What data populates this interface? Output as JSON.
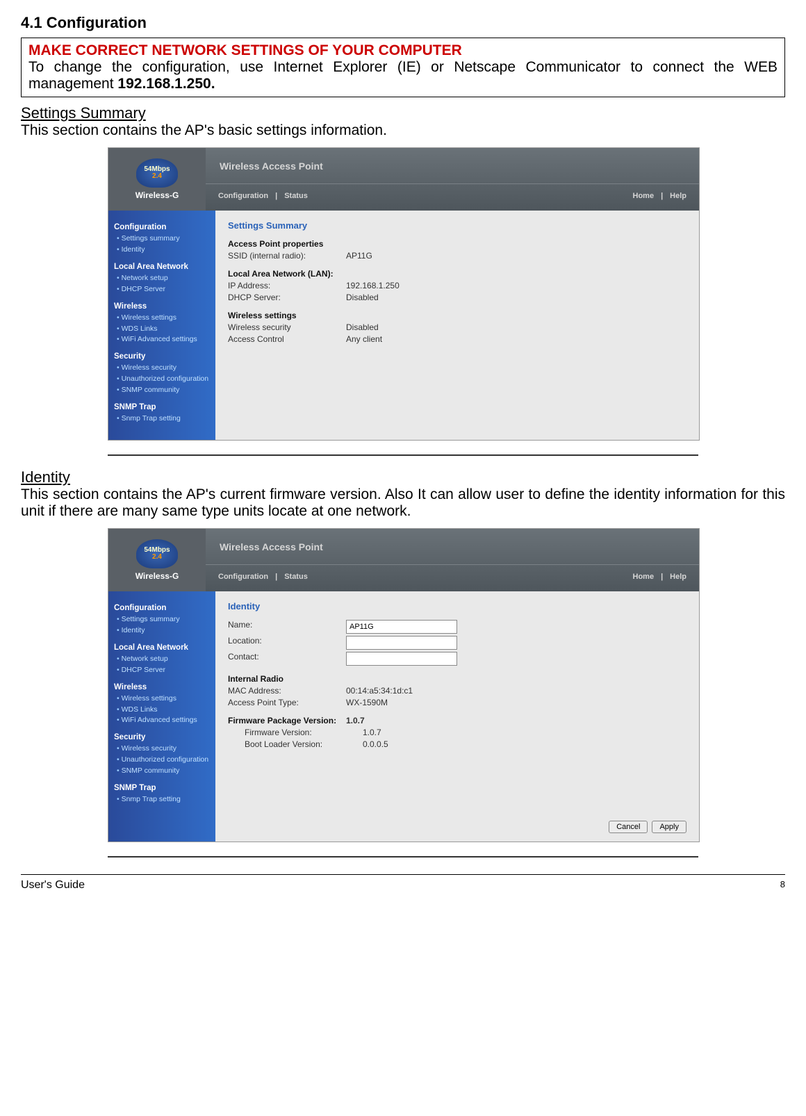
{
  "doc": {
    "section_number_title": "4.1 Configuration",
    "warning_heading": "MAKE CORRECT NETWORK SETTINGS OF YOUR COMPUTER",
    "warning_body_prefix": "To change the configuration, use Internet Explorer (IE) or Netscape Communicator to connect the WEB management ",
    "warning_ip": "192.168.1.250.",
    "settings_heading": "Settings Summary",
    "settings_desc": "This section contains the AP's basic settings information.",
    "identity_heading": "Identity",
    "identity_desc": "This section contains the AP's current firmware version. Also It can allow user to define the identity information for this unit if there are many same type units locate at one network.",
    "footer_left": "User's Guide",
    "footer_page": "8"
  },
  "ap_common": {
    "logo_speed": "54Mbps",
    "logo_band": "2.4",
    "logo_brand": "Wireless-G",
    "header_title": "Wireless Access Point",
    "nav": {
      "configuration": "Configuration",
      "status": "Status",
      "home": "Home",
      "help": "Help",
      "sep": "|"
    },
    "sidebar": {
      "g1": "Configuration",
      "g1_i1": "Settings summary",
      "g1_i2": "Identity",
      "g2": "Local Area Network",
      "g2_i1": "Network setup",
      "g2_i2": "DHCP Server",
      "g3": "Wireless",
      "g3_i1": "Wireless settings",
      "g3_i2": "WDS Links",
      "g3_i3": "WiFi Advanced settings",
      "g4": "Security",
      "g4_i1": "Wireless security",
      "g4_i2": "Unauthorized configuration",
      "g4_i3": "SNMP community",
      "g5": "SNMP Trap",
      "g5_i1": "Snmp Trap setting"
    }
  },
  "shot1": {
    "title": "Settings Summary",
    "grp1": "Access Point properties",
    "r1l": "SSID (internal radio):",
    "r1v": "AP11G",
    "grp2": "Local Area Network (LAN):",
    "r2l": "IP Address:",
    "r2v": "192.168.1.250",
    "r3l": "DHCP Server:",
    "r3v": "Disabled",
    "grp3": "Wireless settings",
    "r4l": "Wireless security",
    "r4v": "Disabled",
    "r5l": "Access Control",
    "r5v": "Any client"
  },
  "shot2": {
    "title": "Identity",
    "r1l": "Name:",
    "r1v": "AP11G",
    "r2l": "Location:",
    "r3l": "Contact:",
    "grp2": "Internal Radio",
    "r4l": "MAC Address:",
    "r4v": "00:14:a5:34:1d:c1",
    "r5l": "Access Point Type:",
    "r5v": "WX-1590M",
    "grp3": "Firmware Package Version:",
    "grp3v": "1.0.7",
    "r6l": "Firmware Version:",
    "r6v": "1.0.7",
    "r7l": "Boot Loader Version:",
    "r7v": "0.0.0.5",
    "btn_cancel": "Cancel",
    "btn_apply": "Apply"
  }
}
